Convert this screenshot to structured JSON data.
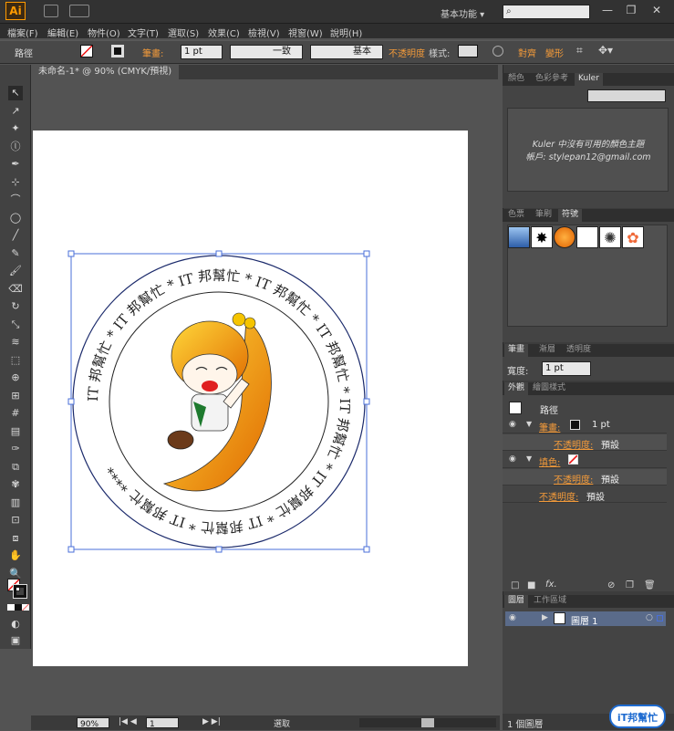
{
  "app": {
    "logo": "Ai",
    "workspace": "基本功能",
    "search_placeholder": "",
    "window_controls": [
      "—",
      "❐",
      "✕"
    ]
  },
  "menu": [
    "檔案(F)",
    "編輯(E)",
    "物件(O)",
    "文字(T)",
    "選取(S)",
    "效果(C)",
    "檢視(V)",
    "視窗(W)",
    "說明(H)"
  ],
  "control": {
    "object_type": "路徑",
    "stroke_label": "筆畫:",
    "stroke_value": "1 pt",
    "profile_label": "一致",
    "brush_label": "基本",
    "opacity_label": "不透明度",
    "style_label": "樣式:",
    "align_label": "對齊",
    "transform_label": "變形"
  },
  "document_tab": {
    "title": "未命名-1* @ 90% (CMYK/預視)",
    "close": "×"
  },
  "toolbar": {
    "tools": [
      "selection-tool",
      "direct-selection-tool",
      "magic-wand-tool",
      "lasso-tool",
      "pen-tool",
      "add-anchor-tool",
      "curvature-tool",
      "ellipse-tool",
      "line-tool",
      "pencil-tool",
      "brush-tool",
      "eraser-tool",
      "rotate-tool",
      "scale-tool",
      "warp-tool",
      "free-transform-tool",
      "shape-builder-tool",
      "perspective-tool",
      "mesh-tool",
      "gradient-tool",
      "eyedropper-tool",
      "blend-tool",
      "symbol-sprayer-tool",
      "column-graph-tool",
      "artboard-tool",
      "slice-tool",
      "hand-tool",
      "zoom-tool"
    ]
  },
  "artwork": {
    "ring_text": "IT 邦幫忙 * IT 邦幫忙 * IT 邦幫忙 * IT 邦幫忙 * IT 邦幫忙 * IT 邦幫忙 * IT 邦幫忙 * IT 邦幫忙 * IT 邦幫忙 ****"
  },
  "panels": {
    "kuler": {
      "tabs": [
        "顏色",
        "色彩參考",
        "Kuler"
      ],
      "active": "Kuler",
      "message": "Kuler 中沒有可用的顏色主題",
      "account": "帳戶: stylepan12@gmail.com"
    },
    "symbols": {
      "tabs": [
        "色票",
        "筆刷",
        "符號"
      ],
      "active": "符號"
    },
    "stroke": {
      "tabs": [
        "筆畫",
        "漸層",
        "透明度"
      ],
      "active": "筆畫",
      "weight_label": "寬度:",
      "weight_value": "1 pt"
    },
    "appearance": {
      "tabs": [
        "外觀",
        "繪圖樣式"
      ],
      "active": "外觀",
      "header": "路徑",
      "rows": [
        {
          "label": "筆畫:",
          "value": "1 pt",
          "kind": "stroke"
        },
        {
          "label": "不透明度:",
          "value": "預設",
          "kind": "sub"
        },
        {
          "label": "填色:",
          "value": "",
          "kind": "fill"
        },
        {
          "label": "不透明度:",
          "value": "預設",
          "kind": "sub"
        },
        {
          "label": "不透明度:",
          "value": "預設",
          "kind": "top"
        }
      ]
    },
    "layers": {
      "tabs": [
        "圖層",
        "工作區域"
      ],
      "active": "圖層",
      "layer_name": "圖層 1",
      "footer": "1 個圖層"
    }
  },
  "status": {
    "zoom": "90%",
    "artboard": "1",
    "mode": "選取"
  },
  "watermark": {
    "text": "iT邦幫忙"
  },
  "colors": {
    "accent": "#f29a3a",
    "selection": "#4a6fd8",
    "panel": "#444444"
  }
}
